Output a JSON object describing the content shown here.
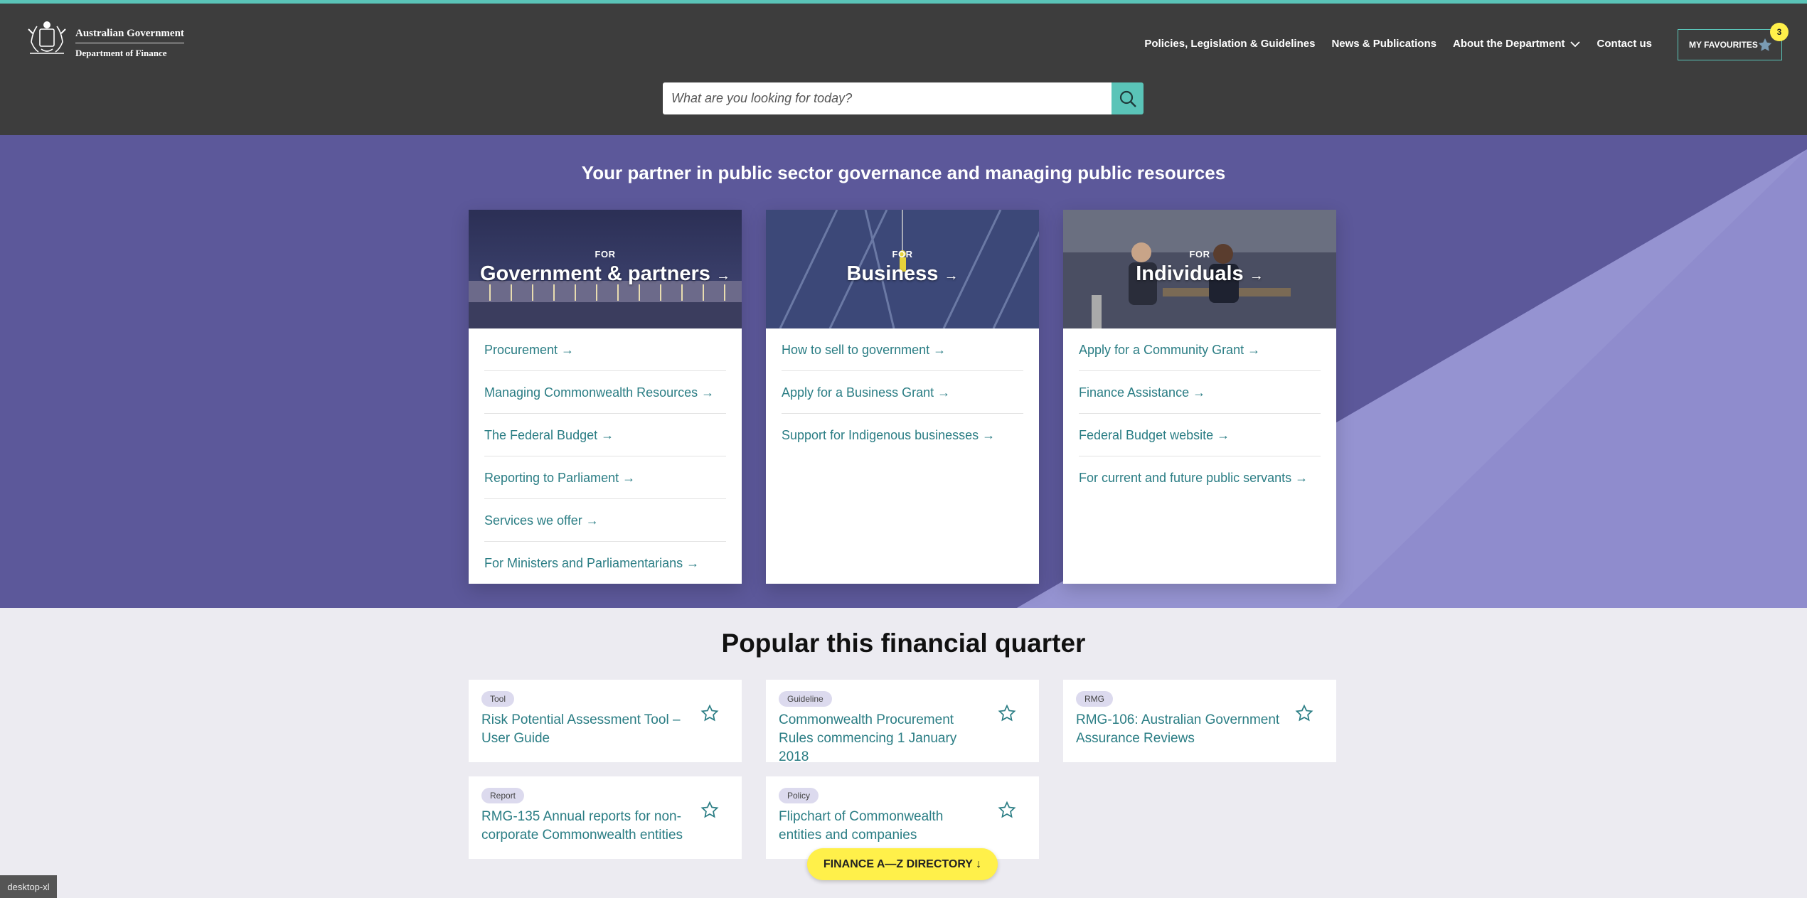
{
  "header": {
    "logo": {
      "line1": "Australian Government",
      "line2": "Department of Finance"
    },
    "nav": [
      {
        "label": "Policies, Legislation & Guidelines"
      },
      {
        "label": "News & Publications"
      },
      {
        "label": "About the Department",
        "has_dropdown": true
      },
      {
        "label": "Contact us"
      }
    ],
    "favourites": {
      "label": "MY FAVOURITES",
      "count": "3"
    },
    "search": {
      "placeholder": "What are you looking for today?"
    }
  },
  "hero": {
    "title": "Your partner in public sector governance and managing public resources",
    "cards": [
      {
        "for": "FOR",
        "name": "Government & partners",
        "links": [
          "Procurement →",
          "Managing Commonwealth Resources →",
          "The Federal Budget →",
          "Reporting to Parliament →",
          "Services we offer →",
          "For Ministers and Parliamentarians →"
        ]
      },
      {
        "for": "FOR",
        "name": "Business",
        "links": [
          "How to sell to government →",
          "Apply for a Business Grant →",
          "Support for Indigenous businesses →"
        ]
      },
      {
        "for": "FOR",
        "name": "Individuals",
        "links": [
          "Apply for a Community Grant →",
          "Finance Assistance →",
          "Federal Budget website →",
          "For current and future public servants →"
        ]
      }
    ]
  },
  "popular": {
    "title": "Popular this financial quarter",
    "items": [
      {
        "tag": "Tool",
        "title": "Risk Potential Assessment Tool – User Guide"
      },
      {
        "tag": "Guideline",
        "title": "Commonwealth Procurement Rules commencing 1 January 2018"
      },
      {
        "tag": "RMG",
        "title": "RMG-106: Australian Government Assurance Reviews"
      },
      {
        "tag": "Report",
        "title": "RMG-135 Annual reports for non-corporate Commonwealth entities"
      },
      {
        "tag": "Policy",
        "title": "Flipchart of Commonwealth entities and companies"
      }
    ]
  },
  "az_directory": {
    "label": "FINANCE A—Z DIRECTORY ↓"
  },
  "device_label": "desktop-xl",
  "colors": {
    "header": "#3d3d3d",
    "teal": "#5ac4b8",
    "hero": "#5c589a",
    "link": "#2a7d84",
    "yellow": "#fff04a"
  }
}
